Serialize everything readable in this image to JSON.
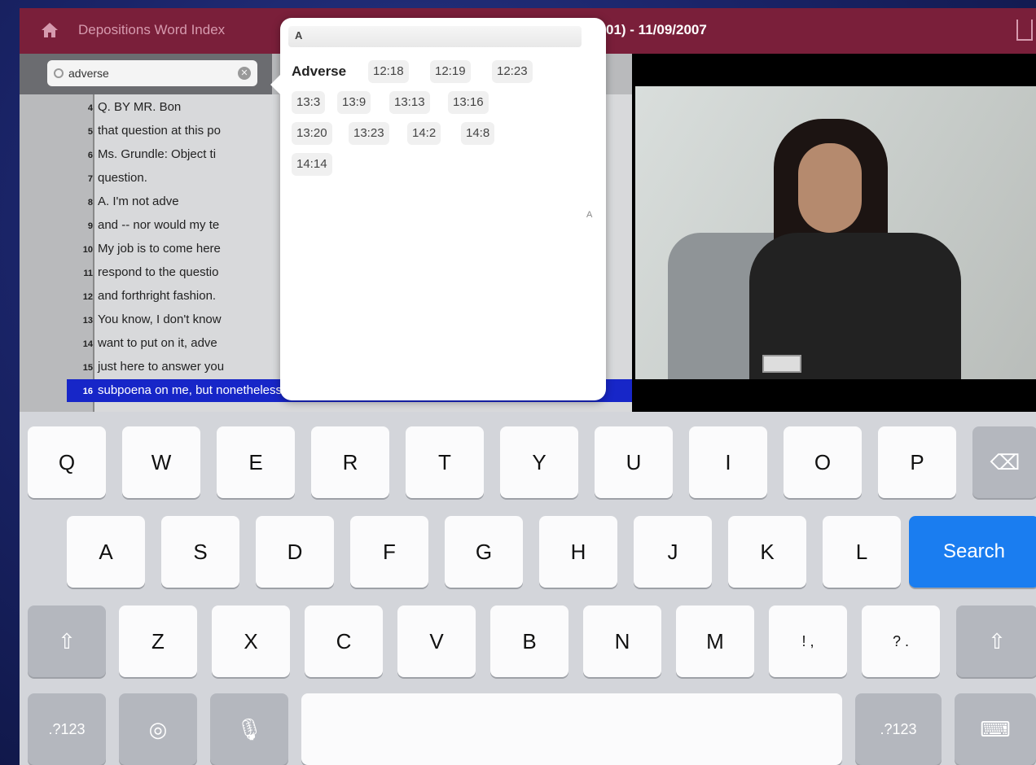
{
  "topbar": {
    "crumb": "Depositions Word Index",
    "title": "01) - 11/09/2007"
  },
  "search": {
    "value": "adverse"
  },
  "transcript": {
    "lines": [
      {
        "num": "4",
        "text": "Q.  BY MR. Bon"
      },
      {
        "num": "5",
        "text": "that question at this po"
      },
      {
        "num": "6",
        "text": "Ms. Grundle:  Object ti"
      },
      {
        "num": "7",
        "text": "question."
      },
      {
        "num": "8",
        "text": "A.  I'm not adve"
      },
      {
        "num": "9",
        "text": "and -- nor would my te"
      },
      {
        "num": "10",
        "text": "My job is to come here"
      },
      {
        "num": "11",
        "text": "respond to the questio"
      },
      {
        "num": "12",
        "text": "and forthright fashion."
      },
      {
        "num": "13",
        "text": "You know, I don't know"
      },
      {
        "num": "14",
        "text": "want to put on it, adve"
      },
      {
        "num": "15",
        "text": "just here to answer you"
      },
      {
        "num": "16",
        "text": "subpoena on me, but nonetheless I voluntarily appeared"
      }
    ]
  },
  "popover": {
    "header_letter": "A",
    "word": "Adverse",
    "side_letter": "A",
    "refs": [
      "12:18",
      "12:19",
      "12:23",
      "13:3",
      "13:9",
      "13:13",
      "13:16",
      "13:20",
      "13:23",
      "14:2",
      "14:8",
      "14:14"
    ]
  },
  "keyboard": {
    "row1": [
      "Q",
      "W",
      "E",
      "R",
      "T",
      "Y",
      "U",
      "I",
      "O",
      "P"
    ],
    "row2": [
      "A",
      "S",
      "D",
      "F",
      "G",
      "H",
      "J",
      "K",
      "L"
    ],
    "row3": [
      "Z",
      "X",
      "C",
      "V",
      "B",
      "N",
      "M",
      "!\n,",
      "?\n."
    ],
    "search_label": "Search",
    "numbers_label": ".?123"
  }
}
